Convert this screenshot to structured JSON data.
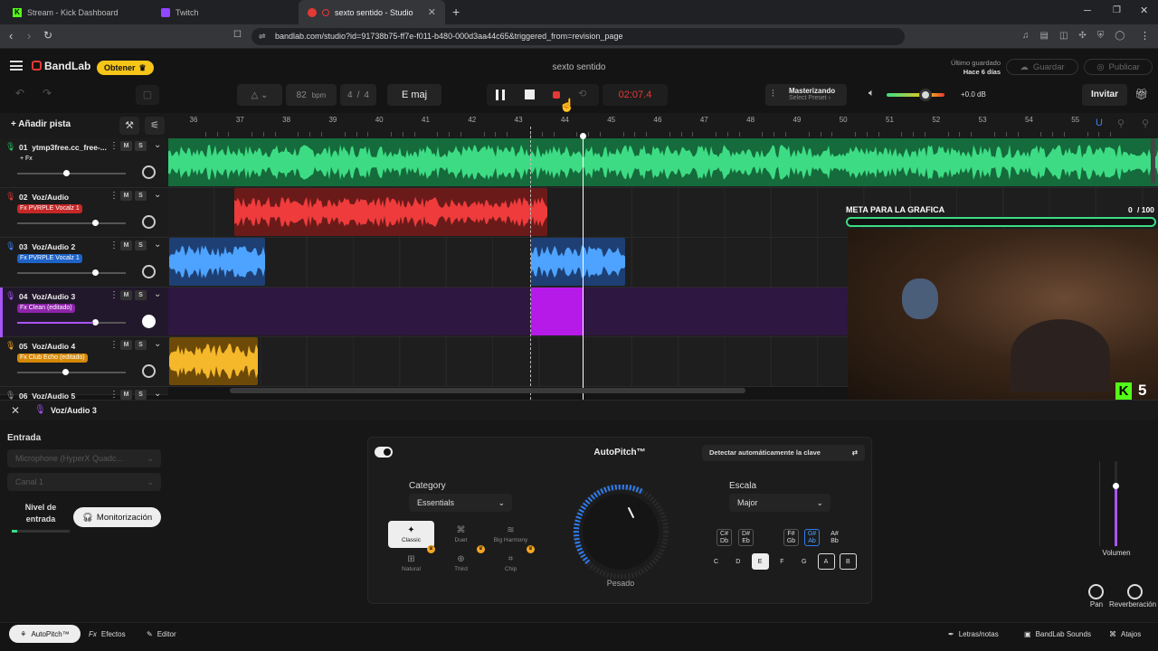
{
  "browser": {
    "tabs": [
      {
        "title": "Stream - Kick Dashboard"
      },
      {
        "title": "Twitch"
      },
      {
        "title": "sexto sentido - Studio"
      }
    ],
    "url": "bandlab.com/studio?id=91738b75-ff7e-f011-b480-000d3aa44c65&triggered_from=revision_page",
    "new_tab": "+"
  },
  "app": {
    "brand": "BandLab",
    "get_label": "Obtener",
    "project_title": "sexto sentido",
    "last_saved_label": "Último guardado",
    "last_saved_value": "Hace 6 días",
    "save_label": "Guardar",
    "publish_label": "Publicar"
  },
  "transport": {
    "bpm_value": "82",
    "bpm_label": "bpm",
    "time_sig_num": "4",
    "time_sig_sep": "/",
    "time_sig_den": "4",
    "key": "E maj",
    "time": "02:07.4",
    "mastering_label": "Masterizando",
    "preset_label": "Select Preset",
    "master_volume": "+0.0 dB",
    "invite_label": "Invitar"
  },
  "tracks_header": {
    "add_track_label": "Añadir pista"
  },
  "ruler": {
    "bars": [
      "36",
      "37",
      "38",
      "39",
      "40",
      "41",
      "42",
      "43",
      "44",
      "45",
      "46",
      "47",
      "48",
      "49",
      "50",
      "51",
      "52",
      "53",
      "54",
      "55"
    ]
  },
  "tracks": [
    {
      "num": "01",
      "name": "ytmp3free.cc_free-...",
      "fx": "+ Fx",
      "color": "#22c55e",
      "fxbg": "transparent"
    },
    {
      "num": "02",
      "name": "Voz/Audio",
      "fx": "Fx PVRPLE Vocalz 1",
      "color": "#e53935",
      "fxbg": "#c62828"
    },
    {
      "num": "03",
      "name": "Voz/Audio 2",
      "fx": "Fx PVRPLE Vocalz 1",
      "color": "#3b82f6",
      "fxbg": "#1e63c8"
    },
    {
      "num": "04",
      "name": "Voz/Audio 3",
      "fx": "Fx Clean (editado)",
      "color": "#a855f7",
      "fxbg": "#8e24aa"
    },
    {
      "num": "05",
      "name": "Voz/Audio 4",
      "fx": "Fx Club Echo (editado)",
      "color": "#f5a623",
      "fxbg": "#d48806"
    },
    {
      "num": "06",
      "name": "Voz/Audio 5"
    }
  ],
  "mute_label": "M",
  "solo_label": "S",
  "overlay": {
    "goal_label": "META PARA LA GRAFICA",
    "goal_current": "0",
    "goal_total": "/ 100",
    "kick_count": "5"
  },
  "selected_track": {
    "name": "Voz/Audio 3"
  },
  "input": {
    "section_label": "Entrada",
    "device": "Microphone (HyperX Quadc...",
    "channel": "Canal 1",
    "level_label": "Nivel de entrada",
    "monitor_label": "Monitorización"
  },
  "autopitch": {
    "title": "AutoPitch™",
    "detect_label": "Detectar automáticamente la clave",
    "category_label": "Category",
    "category_value": "Essentials",
    "styles": [
      {
        "label": "Classic"
      },
      {
        "label": "Duet"
      },
      {
        "label": "Big Harmony"
      },
      {
        "label": "Natural"
      },
      {
        "label": "Third"
      },
      {
        "label": "Chip"
      }
    ],
    "knob_label": "Pesado",
    "scale_label": "Escala",
    "scale_value": "Major",
    "sharp_notes": [
      {
        "top": "C#",
        "bot": "Db"
      },
      {
        "top": "D#",
        "bot": "Eb"
      },
      {
        "top": "F#",
        "bot": "Gb"
      },
      {
        "top": "G#",
        "bot": "Ab"
      },
      {
        "top": "A#",
        "bot": "Bb"
      }
    ],
    "natural_notes": [
      "C",
      "D",
      "E",
      "F",
      "G",
      "A",
      "B"
    ]
  },
  "mixer": {
    "volume_label": "Volumen",
    "pan_label": "Pan",
    "reverb_label": "Reverberación"
  },
  "bottom_bar": {
    "autopitch_tab": "AutoPitch™",
    "effects_tab": "Efectos",
    "editor_tab": "Editor",
    "lyrics_label": "Letras/notas",
    "sounds_label": "BandLab Sounds",
    "shortcuts_label": "Atajos"
  },
  "colors": {
    "accent_red": "#e53935",
    "brand_yellow": "#f5c518",
    "goal_green": "#3ddc84"
  }
}
